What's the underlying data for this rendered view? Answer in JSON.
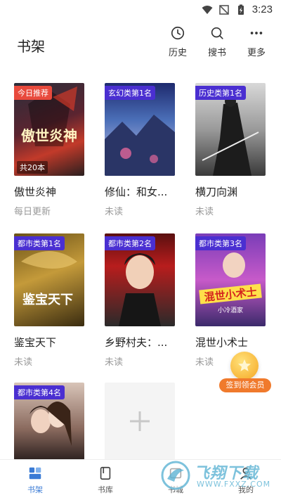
{
  "status_bar": {
    "time": "3:23"
  },
  "header": {
    "title": "书架"
  },
  "toolbar": [
    {
      "icon": "clock-icon",
      "label": "历史"
    },
    {
      "icon": "search-icon",
      "label": "搜书"
    },
    {
      "icon": "more-icon",
      "label": "更多"
    }
  ],
  "books": [
    {
      "badge": "今日推荐",
      "badge_color": "red",
      "title": "傲世炎神",
      "sub": "每日更新",
      "count": "共20本"
    },
    {
      "badge": "玄幻类第1名",
      "badge_color": "purple",
      "title": "修仙：和女...",
      "sub": "未读"
    },
    {
      "badge": "历史类第1名",
      "badge_color": "purple",
      "title": "横刀向渊",
      "sub": "未读"
    },
    {
      "badge": "都市类第1名",
      "badge_color": "purple",
      "title": "鉴宝天下",
      "sub": "未读"
    },
    {
      "badge": "都市类第2名",
      "badge_color": "purple",
      "title": "乡野村夫：...",
      "sub": "未读"
    },
    {
      "badge": "都市类第3名",
      "badge_color": "purple",
      "title": "混世小术士",
      "sub": "未读"
    },
    {
      "badge": "都市类第4名",
      "badge_color": "purple",
      "title": "",
      "sub": ""
    }
  ],
  "cover_text": {
    "book1": "傲世炎神",
    "book4": "鉴宝天下",
    "book6_main": "混世小术士",
    "book6_sub": "小冷酒家"
  },
  "signin": {
    "label": "签到领会员"
  },
  "bottom_nav": [
    {
      "icon": "bookshelf-icon",
      "label": "书架",
      "active": true
    },
    {
      "icon": "library-icon",
      "label": "书库"
    },
    {
      "icon": "collection-icon",
      "label": "书城"
    },
    {
      "icon": "profile-icon",
      "label": "我的"
    }
  ],
  "watermark": {
    "brand": "飞翔下载",
    "url": "WWW.FXXZ.COM"
  },
  "colors": {
    "accent": "#3a7bd5",
    "badge_red": "#e84a3d",
    "badge_purple": "#4a2fd1",
    "signin": "#f07a2c"
  }
}
